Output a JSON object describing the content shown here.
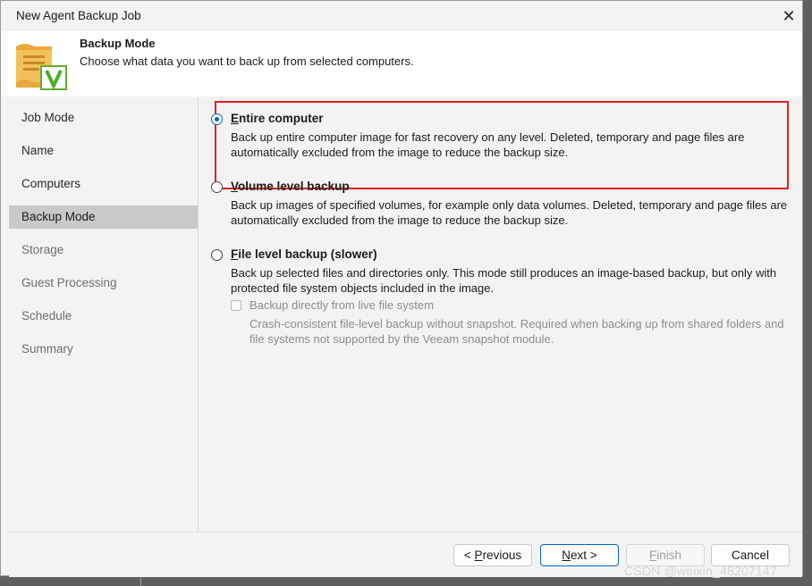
{
  "window": {
    "title": "New Agent Backup Job",
    "close_glyph": "✕"
  },
  "header": {
    "title": "Backup Mode",
    "description": "Choose what data you want to back up from selected computers.",
    "icon": "backup-job-scroll-icon"
  },
  "sidebar": {
    "items": [
      {
        "label": "Job Mode",
        "state": "done"
      },
      {
        "label": "Name",
        "state": "done"
      },
      {
        "label": "Computers",
        "state": "done"
      },
      {
        "label": "Backup Mode",
        "state": "active"
      },
      {
        "label": "Storage",
        "state": "todo"
      },
      {
        "label": "Guest Processing",
        "state": "todo"
      },
      {
        "label": "Schedule",
        "state": "todo"
      },
      {
        "label": "Summary",
        "state": "todo"
      }
    ]
  },
  "options": [
    {
      "mnemonic": "E",
      "label_rest": "ntire computer",
      "checked": true,
      "description": "Back up entire computer image for fast recovery on any level. Deleted, temporary and page files are automatically excluded from the image to reduce the backup size."
    },
    {
      "mnemonic": "V",
      "label_rest": "olume level backup",
      "checked": false,
      "description": "Back up images of specified volumes, for example only data volumes. Deleted, temporary and page files are automatically excluded from the image to reduce the backup size."
    },
    {
      "mnemonic": "F",
      "label_rest": "ile level backup (slower)",
      "checked": false,
      "description": "Back up selected files and directories only. This mode still produces an image-based backup, but only with protected file system objects included in the image."
    }
  ],
  "sub_option": {
    "label": "Backup directly from live file system",
    "checked": false,
    "enabled": false,
    "description": "Crash-consistent file-level backup without snapshot. Required when backing up from shared folders and file systems not supported by the Veeam snapshot module."
  },
  "buttons": {
    "previous": {
      "prefix": "< ",
      "mnemonic": "P",
      "rest": "revious"
    },
    "next": {
      "mnemonic": "N",
      "rest": "ext >"
    },
    "finish": {
      "mnemonic": "F",
      "rest": "inish"
    },
    "cancel": {
      "label": "Cancel"
    }
  },
  "colors": {
    "accent": "#0067c0",
    "highlight_box": "#e0231b",
    "active_nav": "#c9c9c9"
  },
  "watermark": "CSDN @weixin_48207147"
}
